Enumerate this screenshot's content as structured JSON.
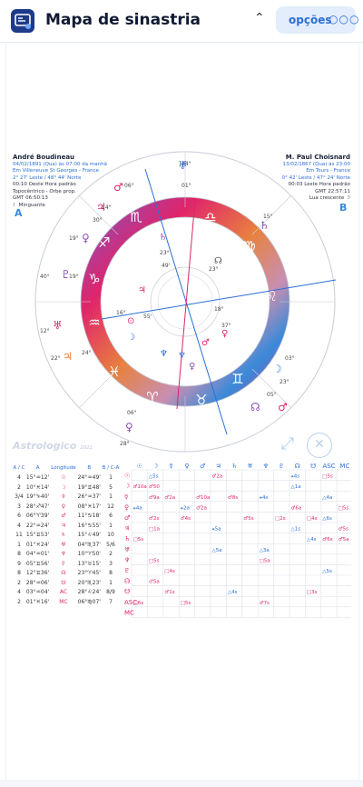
{
  "header": {
    "title": "Mapa de sinastria",
    "options_label": "opções",
    "options_dots": "○○○"
  },
  "personA": {
    "name": "André Boudineau",
    "line1": "04/02/1891 (Qua) às 07:00 da manhã",
    "line2": "Em Villeneuve St Georges - France",
    "line3": "2° 27' Leste / 48° 44' Norte",
    "line4": "00:10 Oeste Hora padrão",
    "line5": "Topocêntrico - Orbe prop.",
    "line6": "GMT 06:50:13",
    "line7": "☾ Minguante",
    "letter": "A"
  },
  "personB": {
    "name": "M. Paul Choisnard",
    "line1": "13/02/1867 (Qua) às 23:00",
    "line2": "Em Tours - France",
    "line3": "0° 42' Leste / 47° 24' Norte",
    "line4": "00:03 Leste Hora padrão",
    "line5": "GMT 22:57:11",
    "line6": "Lua crescente ☽",
    "letter": "B"
  },
  "watermark": "Astrologico",
  "watermark_sub": "2021",
  "table": {
    "headers": [
      "A / C",
      "A",
      "Longitude",
      "B",
      "B / C-A"
    ],
    "rows": [
      [
        "4",
        "15°♒12'",
        "☉",
        "24°♒49'",
        "1"
      ],
      [
        "2",
        "10°♓14'",
        "☽",
        "19°♊48'",
        "5"
      ],
      [
        "3/4",
        "19°♑40'",
        "☿",
        "26°♒37'",
        "1"
      ],
      [
        "3",
        "28°♐47'",
        "♀",
        "08°♓17'",
        "12"
      ],
      [
        "6",
        "06°♈39'",
        "♂",
        "11°♋18'",
        "6"
      ],
      [
        "4",
        "22°♒24'",
        "♃",
        "16°♋55'",
        "1"
      ],
      [
        "11",
        "15°♊53'",
        "♄",
        "15°♌49'",
        "10"
      ],
      [
        "1",
        "01°♓24'",
        "♅",
        "04°♏37'",
        "5/6"
      ],
      [
        "8",
        "04°♒01'",
        "♆",
        "10°♈50'",
        "2"
      ],
      [
        "9",
        "05°♊56'",
        "♇",
        "13°♉15'",
        "3"
      ],
      [
        "8",
        "12°♊36'",
        "☊",
        "23°♈45'",
        "8"
      ],
      [
        "2",
        "28°♒06'",
        "☋",
        "20°♏23'",
        "1"
      ],
      [
        "4",
        "03°♒04'",
        "AC",
        "28°♌24'",
        "8/9"
      ],
      [
        "2",
        "01°♓16'",
        "MC",
        "06°♍07'",
        "7"
      ]
    ]
  },
  "grid": {
    "col_headers": [
      "☉",
      "☽",
      "☿",
      "♀",
      "♂",
      "♃",
      "♄",
      "♅",
      "♆",
      "♇",
      "☊",
      "☋",
      "ASC",
      "MC"
    ],
    "row_headers": [
      "☉",
      "☽",
      "☿",
      "♀",
      "♂",
      "♃",
      "♄",
      "♅",
      "♆",
      "♇",
      "☊",
      "☋",
      "ASC",
      "MC"
    ],
    "cells": [
      [
        [
          1,
          "△5s"
        ],
        [
          5,
          "♂2a"
        ],
        [
          10,
          "⚹4s"
        ],
        [
          12,
          "□5s"
        ],
        [
          15,
          "♂9a"
        ]
      ],
      [
        [
          0,
          "♂10a"
        ],
        [
          1,
          "♂50"
        ],
        [
          10,
          "△1a"
        ],
        [
          15,
          "△4a"
        ]
      ],
      [
        [
          1,
          "♂9a"
        ],
        [
          2,
          "♂2a"
        ],
        [
          4,
          "♂10a"
        ],
        [
          6,
          "♂8s"
        ],
        [
          8,
          "⚹4s"
        ],
        [
          12,
          "△4a"
        ]
      ],
      [
        [
          0,
          "⚹4a"
        ],
        [
          3,
          "⚹2a"
        ],
        [
          4,
          "♂2a"
        ],
        [
          10,
          "♂6a"
        ],
        [
          13,
          "□5s"
        ],
        [
          14,
          "⚹0a"
        ]
      ],
      [
        [
          1,
          "♂2s"
        ],
        [
          3,
          "♂4s"
        ],
        [
          7,
          "♂5s"
        ],
        [
          9,
          "□2s"
        ],
        [
          11,
          "□4s"
        ],
        [
          12,
          "△6s"
        ]
      ],
      [
        [
          1,
          "□1a"
        ],
        [
          5,
          "⚹5a"
        ],
        [
          10,
          "△1s"
        ],
        [
          13,
          "♂5s"
        ]
      ],
      [
        [
          0,
          "□5s"
        ],
        [
          11,
          "△4s"
        ],
        [
          12,
          "♂6s"
        ],
        [
          13,
          "♂5a"
        ]
      ],
      [
        [
          5,
          "△5a"
        ],
        [
          8,
          "△3a"
        ],
        [
          14,
          "⚹5s"
        ]
      ],
      [
        [
          1,
          "□5s"
        ],
        [
          8,
          "□5a"
        ],
        [
          14,
          "⚹0s"
        ]
      ],
      [
        [
          2,
          "□4s"
        ],
        [
          12,
          "△5s"
        ],
        [
          14,
          "□5s"
        ]
      ],
      [
        [
          1,
          "♂5a"
        ]
      ],
      [
        [
          2,
          "♂1s"
        ],
        [
          6,
          "△4s"
        ],
        [
          11,
          "□3s"
        ]
      ],
      [
        [
          0,
          "□6s"
        ],
        [
          3,
          "□5s"
        ],
        [
          8,
          "♂7s"
        ]
      ]
    ]
  },
  "colors": {
    "accent": "#2b6fd6",
    "fire": "#e0246b",
    "earth": "#8a4fb8",
    "air": "#e8813f",
    "water": "#3b8ad9"
  }
}
